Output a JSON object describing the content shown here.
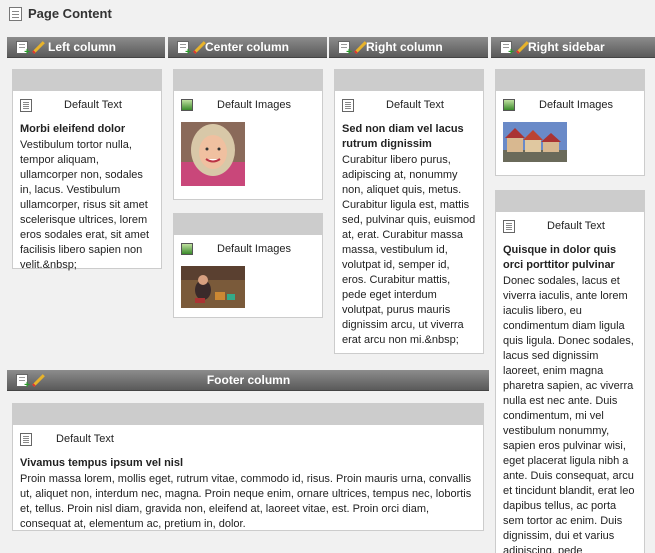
{
  "page": {
    "title": "Page Content"
  },
  "columns": {
    "left": {
      "label": "Left column"
    },
    "center": {
      "label": "Center column"
    },
    "right": {
      "label": "Right column"
    },
    "sidebar": {
      "label": "Right sidebar"
    },
    "footer": {
      "label": "Footer column"
    }
  },
  "content": {
    "left_text": {
      "type": "Default Text",
      "heading": "Morbi eleifend dolor",
      "body": "Vestibulum tortor nulla, tempor aliquam, ullamcorper non, sodales in, lacus. Vestibulum ullamcorper, risus sit amet scelerisque ultrices, lorem eros sodales erat, sit amet facilisis libero sapien non velit.&nbsp;"
    },
    "center_images_1": {
      "type": "Default Images"
    },
    "center_images_2": {
      "type": "Default Images"
    },
    "right_text": {
      "type": "Default Text",
      "heading": "Sed non diam vel lacus rutrum dignissim",
      "body": "Curabitur libero purus, adipiscing at, nonummy non, aliquet quis, metus. Curabitur ligula est, mattis sed, pulvinar quis, euismod at, erat. Curabitur massa massa, vestibulum id, volutpat id, semper id, eros. Curabitur mattis, pede eget interdum volutpat, purus mauris dignissim arcu, ut viverra erat arcu non mi.&nbsp;"
    },
    "sidebar_images": {
      "type": "Default Images"
    },
    "sidebar_text": {
      "type": "Default Text",
      "heading": "Quisque in dolor quis orci porttitor pulvinar",
      "body": "Donec sodales, lacus et viverra iaculis, ante lorem iaculis libero, eu condimentum diam ligula quis ligula. Donec sodales, lacus sed dignissim laoreet, enim magna pharetra sapien, ac viverra nulla est nec ante. Duis condimentum, mi vel vestibulum nonummy, sapien eros pulvinar wisi, eget placerat ligula nibh a ante. Duis consequat, arcu et tincidunt blandit, erat leo dapibus tellus, ac porta sem tortor ac enim. Duis dignissim, dui et varius adipiscing, pede"
    },
    "footer_text": {
      "type": "Default Text",
      "heading": "Vivamus tempus ipsum vel nisl",
      "body": "Proin massa lorem, mollis eget, rutrum vitae, commodo id, risus. Proin mauris urna, convallis ut, aliquet non, interdum nec, magna. Proin neque enim, ornare ultrices, tempus nec, lobortis et, tellus. Proin nisl diam, gravida non, eleifend at, laoreet vitae, est. Proin orci diam, consequat at, elementum ac, pretium in, dolor."
    }
  }
}
